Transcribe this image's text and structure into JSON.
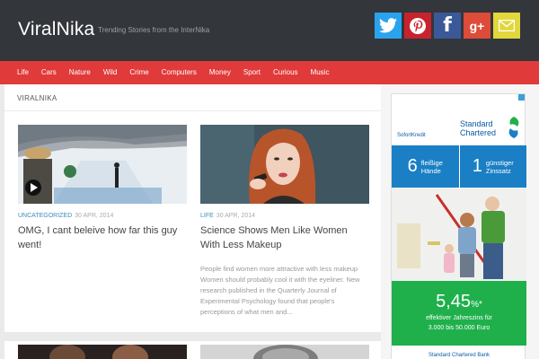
{
  "header": {
    "site_title": "ViralNika",
    "tagline": "Trending Stories from the InterNika",
    "social": [
      {
        "name": "twitter-icon",
        "color": "#2aa3ef"
      },
      {
        "name": "pinterest-icon",
        "color": "#c8232c"
      },
      {
        "name": "facebook-icon",
        "color": "#3b5998",
        "glyph": "f"
      },
      {
        "name": "google-plus-icon",
        "color": "#dd4b39",
        "glyph": "g+"
      },
      {
        "name": "email-icon",
        "color": "#e2d73c"
      }
    ]
  },
  "nav": {
    "items": [
      "Life",
      "Cars",
      "Nature",
      "Wild",
      "Crime",
      "Computers",
      "Money",
      "Sport",
      "Curious",
      "Music"
    ]
  },
  "breadcrumb": "VIRALNIKA",
  "posts": [
    {
      "category": "UNCATEGORIZED",
      "date": "30 APR, 2014",
      "title": "OMG, I cant beleive how far this guy went!",
      "excerpt": ""
    },
    {
      "category": "LIFE",
      "date": "30 APR, 2014",
      "title": "Science Shows Men Like Women With Less Makeup",
      "excerpt": "People find women more attractive with less makeup Women should probably cool it with the eyeliner. New research published in the Quarterly Journal of Experimental Psychology found that people's perceptions of what men and..."
    }
  ],
  "ad": {
    "small_brand": "SofortKredit",
    "brand_line1": "Standard",
    "brand_line2": "Chartered",
    "box1_num": "6",
    "box1_line1": "fleißige",
    "box1_line2": "Hände",
    "box2_num": "1",
    "box2_line1": "günstiger",
    "box2_line2": "Zinssatz",
    "rate": "5,45",
    "rate_suffix": "%*",
    "rate_line1": "effektiver Jahreszins für",
    "rate_line2": "3.000 bis 50.000 Euro",
    "bank": "Standard Chartered Bank"
  },
  "colors": {
    "header_bg": "#33363b",
    "nav_bg": "#e03a3a",
    "category": "#3b8dbd",
    "ad_blue": "#1a7fc4",
    "ad_green": "#1fb04b"
  }
}
